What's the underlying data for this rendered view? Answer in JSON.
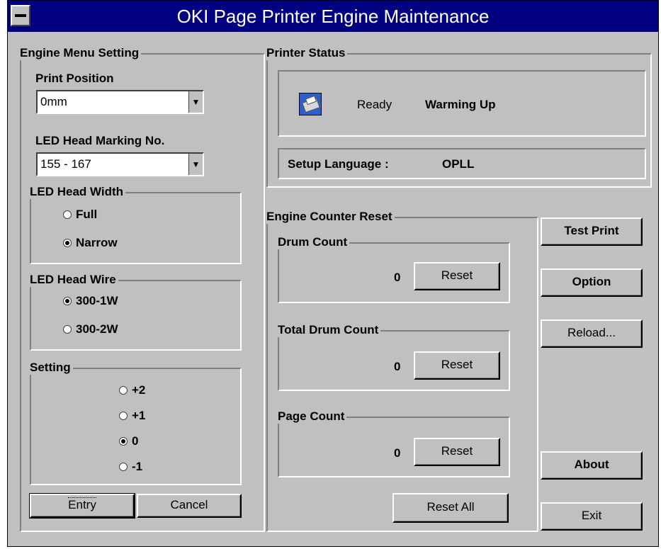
{
  "window": {
    "title": "OKI Page Printer Engine Maintenance"
  },
  "engine_menu": {
    "title": "Engine Menu Setting",
    "print_position": {
      "label": "Print Position",
      "value": "0mm"
    },
    "led_head_marking": {
      "label": "LED Head Marking No.",
      "value": "155 - 167"
    },
    "led_head_width": {
      "title": "LED Head Width",
      "options": [
        "Full",
        "Narrow"
      ],
      "selected": "Narrow"
    },
    "led_head_wire": {
      "title": "LED Head Wire",
      "options": [
        "300-1W",
        "300-2W"
      ],
      "selected": "300-1W"
    },
    "setting": {
      "title": "Setting",
      "options": [
        "+2",
        "+1",
        "0",
        "-1"
      ],
      "selected": "0"
    },
    "entry_label": "Entry",
    "cancel_label": "Cancel"
  },
  "printer_status": {
    "title": "Printer Status",
    "status1": "Ready",
    "status2": "Warming Up",
    "setup_language_label": "Setup Language :",
    "setup_language_value": "OPLL",
    "icon": "printer-icon"
  },
  "counter_reset": {
    "title": "Engine Counter Reset",
    "drum": {
      "title": "Drum Count",
      "value": "0",
      "reset_label": "Reset"
    },
    "total_drum": {
      "title": "Total Drum Count",
      "value": "0",
      "reset_label": "Reset"
    },
    "page": {
      "title": "Page Count",
      "value": "0",
      "reset_label": "Reset"
    },
    "reset_all_label": "Reset All"
  },
  "side_buttons": {
    "test_print": "Test Print",
    "option": "Option",
    "reload": "Reload...",
    "about": "About",
    "exit": "Exit"
  }
}
